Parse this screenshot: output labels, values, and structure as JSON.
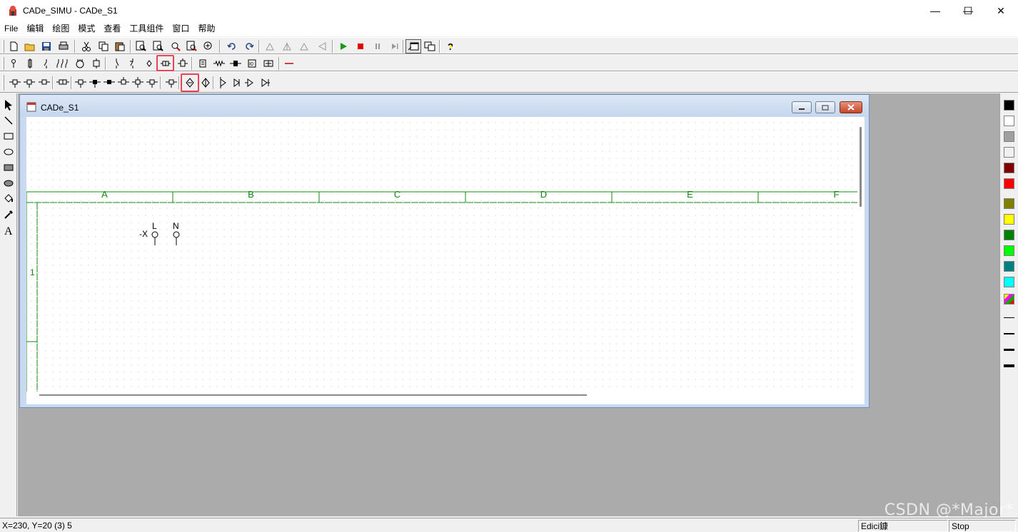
{
  "app": {
    "title": "CADe_SIMU - CADe_S1",
    "window_controls": {
      "minimize": "—",
      "maximize": "☐",
      "close": "✕"
    }
  },
  "menu": [
    "File",
    "编辑",
    "绘图",
    "模式",
    "查看",
    "工具组件",
    "窗口",
    "帮助"
  ],
  "toolbar_standard": {
    "icons": [
      "new-icon",
      "open-icon",
      "save-icon",
      "print-icon",
      "cut-icon",
      "copy-icon",
      "paste-icon",
      "zoom-icon",
      "zoom-out-icon",
      "zoom-area-icon",
      "zoom-page-icon",
      "zoom-fit-icon",
      "undo-icon",
      "redo-icon",
      "rotate-icon",
      "mirror-icon",
      "mirror-v-icon",
      "flip-icon",
      "play-icon",
      "stop-icon",
      "pause-icon",
      "step-icon",
      "window-icon",
      "window-tile-icon",
      "help-icon"
    ]
  },
  "toolbar_components": {
    "highlighted": "terminal-block-icon"
  },
  "toolbar_contacts": {
    "highlighted": "contact-special-icon"
  },
  "child_window": {
    "title": "CADe_S1"
  },
  "drawing": {
    "columns": [
      "A",
      "B",
      "C",
      "D",
      "E",
      "F"
    ],
    "rows": [
      "1"
    ],
    "terminal_ref": "-X",
    "terminal_labels": [
      "L",
      "N"
    ]
  },
  "colors": {
    "palette": [
      "#000000",
      "#ffffff",
      "#a0a0a0",
      "#f0f0f0",
      "#800000",
      "#ff0000",
      "#808000",
      "#ffff00",
      "#008000",
      "#00ff00",
      "#008080",
      "#00ffff"
    ],
    "frame_green": "#118811",
    "highlight": "#e8435a",
    "mdi_background": "#ababab"
  },
  "status": {
    "coords": "X=230, Y=20 (3) 5",
    "mode": "Edici鏮",
    "sim_state": "Stop"
  },
  "watermark": "CSDN @*Major*"
}
